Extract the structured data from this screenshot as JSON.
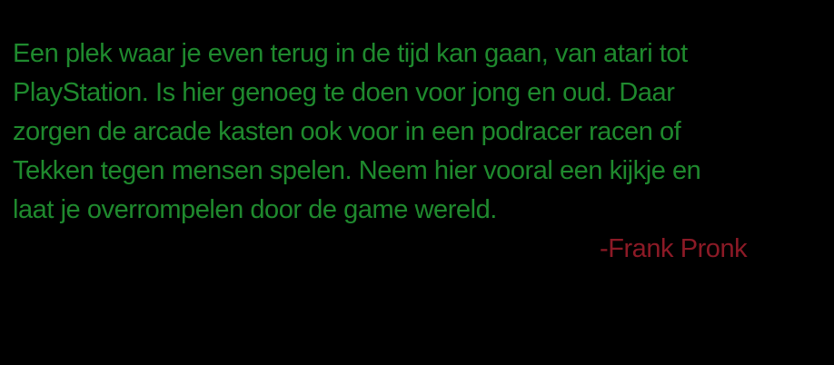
{
  "quote": {
    "lines": [
      "Een plek waar je even terug in de tijd kan gaan, van atari tot",
      "PlayStation. Is hier genoeg te doen voor jong en oud. Daar",
      "zorgen de arcade kasten ook voor in een podracer racen of",
      "Tekken tegen mensen spelen. Neem hier vooral een kijkje en",
      "laat je overrompelen door de game wereld."
    ],
    "color": "#1f8a2e"
  },
  "attribution": {
    "text": "-Frank Pronk",
    "color": "#8c1a26"
  },
  "background_color": "#000000"
}
